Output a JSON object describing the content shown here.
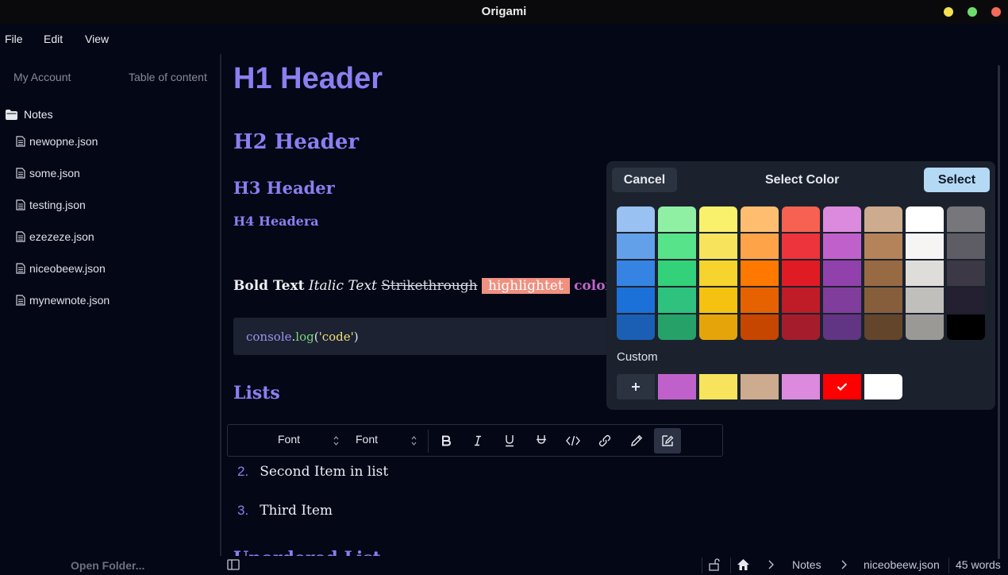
{
  "app": {
    "title": "Origami"
  },
  "window_controls": {
    "minimize_color": "#f4e04d",
    "maximize_color": "#6fdc6f",
    "close_color": "#f26b5b"
  },
  "menu": {
    "items": [
      "File",
      "Edit",
      "View"
    ]
  },
  "sidebar": {
    "tabs": [
      "My Account",
      "Table of content"
    ],
    "folder": {
      "label": "Notes",
      "icon": "folder-icon"
    },
    "files": [
      "newopne.json",
      "some.json",
      "testing.json",
      "ezezeze.json",
      "niceobeew.json",
      "mynewnote.json"
    ],
    "open_folder_label": "Open Folder..."
  },
  "editor": {
    "h1": "H1 Header",
    "h2": "H2 Header",
    "h3": "H3 Header",
    "h4": "H4 Headera",
    "text_line": {
      "bold": "Bold Text",
      "italic": "Italic Text",
      "strike": "Strikethrough",
      "highlight": "highlightet",
      "colored": "colored te"
    },
    "code": {
      "obj": "console",
      "dot": ".",
      "fn": "log",
      "open": "(",
      "str": "'code'",
      "close": ")"
    },
    "lists_header": "Lists",
    "list_items": [
      {
        "num": "2.",
        "text": "Second Item in list"
      },
      {
        "num": "3.",
        "text": "Third Item"
      }
    ],
    "cut_header": "Unordered List"
  },
  "toolbar": {
    "font_family_label": "Font",
    "font_size_label": "Font",
    "buttons": [
      "bold",
      "italic",
      "underline",
      "strikethrough",
      "code",
      "link",
      "pencil",
      "highlight"
    ]
  },
  "color_picker": {
    "cancel_label": "Cancel",
    "title": "Select Color",
    "select_label": "Select",
    "palette": [
      [
        "#99c1f1",
        "#62a0ea",
        "#3584e4",
        "#1c71d8",
        "#1a5fb4"
      ],
      [
        "#8ff0a4",
        "#57e389",
        "#33d17a",
        "#2ec27e",
        "#26a269"
      ],
      [
        "#f9f06b",
        "#f8e45c",
        "#f6d32d",
        "#f5c211",
        "#e5a50a"
      ],
      [
        "#ffbe6f",
        "#ffa348",
        "#ff7800",
        "#e66100",
        "#c64600"
      ],
      [
        "#f66151",
        "#ed333b",
        "#e01b24",
        "#c01c28",
        "#a51d2d"
      ],
      [
        "#dc8add",
        "#c061cb",
        "#9141ac",
        "#813d9c",
        "#613583"
      ],
      [
        "#cdab8f",
        "#b5835a",
        "#986a44",
        "#865e3c",
        "#63452c"
      ],
      [
        "#ffffff",
        "#f6f5f4",
        "#deddda",
        "#c0bfbc",
        "#9a9996"
      ],
      [
        "#77767b",
        "#5e5c64",
        "#3d3846",
        "#241f31",
        "#000000"
      ]
    ],
    "custom_label": "Custom",
    "custom_swatches": [
      "#c061cb",
      "#f8e45c",
      "#cdab8f",
      "#dc8add",
      "#ff0000",
      "#ffffff"
    ],
    "selected_custom_index": 4
  },
  "statusbar": {
    "breadcrumb": [
      "Notes",
      "niceobeew.json"
    ],
    "word_count": "45 words"
  }
}
